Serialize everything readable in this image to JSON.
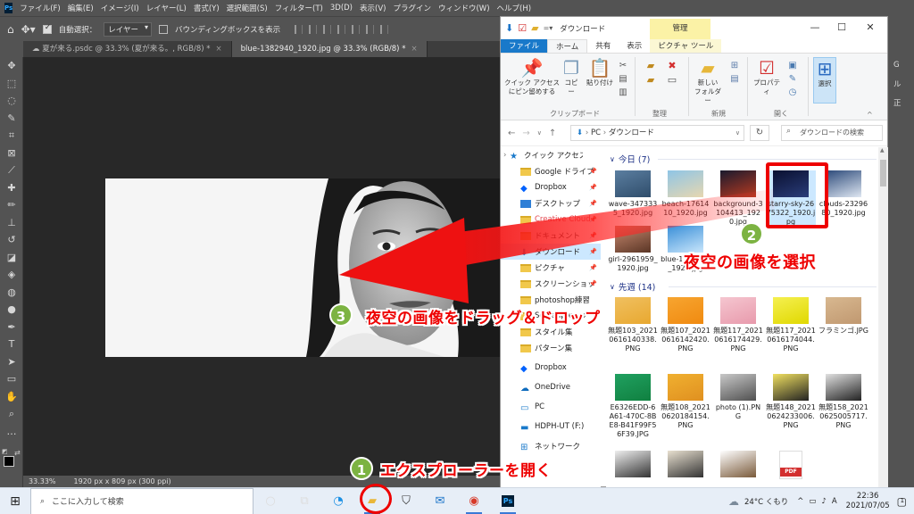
{
  "photoshop": {
    "logo": "Ps",
    "menu": [
      "ファイル(F)",
      "編集(E)",
      "イメージ(I)",
      "レイヤー(L)",
      "書式(Y)",
      "選択範囲(S)",
      "フィルター(T)",
      "3D(D)",
      "表示(V)",
      "プラグイン",
      "ウィンドウ(W)",
      "ヘルプ(H)"
    ],
    "options": {
      "auto_select_label": "自動選択：",
      "layer_select": "レイヤー",
      "bounding_box_label": "バウンディングボックスを表示"
    },
    "tabs": [
      {
        "label": "夏が来る.psdc @ 33.3% (夏が来る。, RGB/8) *",
        "close": "×"
      },
      {
        "label": "blue-1382940_1920.jpg @ 33.3% (RGB/8) *",
        "close": "×"
      }
    ],
    "status": {
      "zoom": "33.33%",
      "doc_info": "1920 px x 809 px (300 ppi)"
    },
    "right_panel_chars": [
      "G",
      "ル",
      "正"
    ]
  },
  "explorer": {
    "title": "ダウンロード",
    "manage_tab": "管理",
    "window_buttons": {
      "minimize": "—",
      "maximize": "☐",
      "close": "✕"
    },
    "ribbon_tabs": [
      "ファイル",
      "ホーム",
      "共有",
      "表示",
      "ピクチャ ツール"
    ],
    "ribbon": {
      "quick_access": "クイック アクセス\nにピン留めする",
      "copy": "コピー",
      "paste": "貼り付け",
      "clipboard_group": "クリップボード",
      "organize_group": "整理",
      "new_folder": "新しい\nフォルダー",
      "new_group": "新規",
      "properties": "プロパティ",
      "open_group": "開く",
      "select": "選択"
    },
    "address": {
      "path": [
        "PC",
        "ダウンロード"
      ],
      "search_placeholder": "ダウンロードの検索"
    },
    "nav_items": [
      {
        "label": "クイック アクセス",
        "icon": "star-icon",
        "pinned": false
      },
      {
        "label": "Google ドライブ",
        "icon": "folder-icon",
        "pinned": true
      },
      {
        "label": "Dropbox",
        "icon": "dropbox-icon",
        "pinned": true
      },
      {
        "label": "デスクトップ",
        "icon": "desktop-icon",
        "pinned": true
      },
      {
        "label": "Creative Cloud",
        "icon": "folder-icon",
        "pinned": true,
        "color": "#e34850"
      },
      {
        "label": "ドキュメント",
        "icon": "folder-icon",
        "pinned": true
      },
      {
        "label": "ダウンロード",
        "icon": "download-icon",
        "pinned": true,
        "selected": true
      },
      {
        "label": "ピクチャ",
        "icon": "folder-icon",
        "pinned": true
      },
      {
        "label": "スクリーンショット",
        "icon": "folder-icon",
        "pinned": true
      },
      {
        "label": "photoshop練習",
        "icon": "folder-icon",
        "pinned": false
      },
      {
        "label": "Screenpresso",
        "icon": "folder-icon",
        "pinned": false
      },
      {
        "label": "スタイル集",
        "icon": "folder-icon",
        "pinned": false
      },
      {
        "label": "パターン集",
        "icon": "folder-icon",
        "pinned": false
      },
      {
        "label": "",
        "icon": "",
        "pinned": false
      },
      {
        "label": "Dropbox",
        "icon": "dropbox-icon",
        "pinned": false
      },
      {
        "label": "",
        "icon": "",
        "pinned": false
      },
      {
        "label": "OneDrive",
        "icon": "cloud-icon",
        "pinned": false
      },
      {
        "label": "",
        "icon": "",
        "pinned": false
      },
      {
        "label": "PC",
        "icon": "pc-icon",
        "pinned": false
      },
      {
        "label": "",
        "icon": "",
        "pinned": false
      },
      {
        "label": "HDPH-UT (F:)",
        "icon": "drive-icon",
        "pinned": false
      },
      {
        "label": "",
        "icon": "",
        "pinned": false
      },
      {
        "label": "ネットワーク",
        "icon": "network-icon",
        "pinned": false
      }
    ],
    "groups": [
      {
        "label": "今日 (7)"
      },
      {
        "label": "先週 (14)"
      }
    ],
    "today_files": [
      {
        "name": "wave-3473335_1920.jpg",
        "thumb": [
          "#5b7ea0",
          "#2f4d6b"
        ]
      },
      {
        "name": "beach-1761410_1920.jpg",
        "thumb": [
          "#8fc5e6",
          "#e7d7b0"
        ]
      },
      {
        "name": "background-3104413_1920.jpg",
        "thumb": [
          "#1a1a2e",
          "#b83a20"
        ]
      },
      {
        "name": "starry-sky-2675322_1920.jpg",
        "thumb": [
          "#0a1030",
          "#2a3d7a"
        ],
        "selected": true
      },
      {
        "name": "clouds-2329680_1920.jpg",
        "thumb": [
          "#2c4a7a",
          "#dfe7f2"
        ]
      },
      {
        "name": "girl-2961959_1920.jpg",
        "thumb": [
          "#c88a70",
          "#5a3525"
        ]
      },
      {
        "name": "blue-1382940_1920.jpg",
        "thumb": [
          "#3a8fd8",
          "#c9e6fb"
        ]
      }
    ],
    "week_files": [
      {
        "name": "無題103_20210616140338.PNG",
        "thumb": [
          "#f0c060",
          "#e8a830"
        ]
      },
      {
        "name": "無題107_20210616142420.PNG",
        "thumb": [
          "#f7a530",
          "#f08a10"
        ]
      },
      {
        "name": "無題117_20210616174429.PNG",
        "thumb": [
          "#f5c6d0",
          "#e89aac"
        ]
      },
      {
        "name": "無題117_20210616174044.PNG",
        "thumb": [
          "#f5f050",
          "#e0d800"
        ]
      },
      {
        "name": "フラミンゴ.JPG",
        "thumb": [
          "#d8b890",
          "#c09870"
        ]
      },
      {
        "name": "E6326EDD-6A61-470C-8BE8-B41F99F56F39.JPG",
        "thumb": [
          "#20a060",
          "#108040"
        ]
      },
      {
        "name": "無題108_20210620184154.PNG",
        "thumb": [
          "#f0b030",
          "#e09020"
        ]
      },
      {
        "name": "photo (1).PNG",
        "thumb": [
          "#c8c8c8",
          "#505050"
        ]
      },
      {
        "name": "無題148_20210624233006.PNG",
        "thumb": [
          "#f0e060",
          "#222222"
        ]
      },
      {
        "name": "無題158_20210625005717.PNG",
        "thumb": [
          "#e0e0e0",
          "#222222"
        ]
      },
      {
        "name": "",
        "thumb": [
          "#eeeeee",
          "#333333"
        ]
      },
      {
        "name": "",
        "thumb": [
          "#e8e0d0",
          "#333333"
        ]
      },
      {
        "name": "",
        "thumb": [
          "#ffffff",
          "#7a5a3a"
        ]
      },
      {
        "name": "",
        "thumb": [
          "#ffffff",
          "#d32f2f"
        ],
        "pdf": "PDF"
      }
    ]
  },
  "annotations": [
    {
      "num": "1",
      "text": "エクスプローラーを開く"
    },
    {
      "num": "2",
      "text": "夜空の画像を選択"
    },
    {
      "num": "3",
      "text": "夜空の画像をドラッグ＆ドロップ"
    }
  ],
  "taskbar": {
    "search_placeholder": "ここに入力して検索",
    "weather": "24°C くもり",
    "ime": "A",
    "time": "22:36",
    "date": "2021/07/05",
    "notification_count": "1"
  },
  "colors": {
    "annotation_red": "#e00000",
    "annotation_green": "#7cb342",
    "explorer_blue": "#1979ca"
  }
}
